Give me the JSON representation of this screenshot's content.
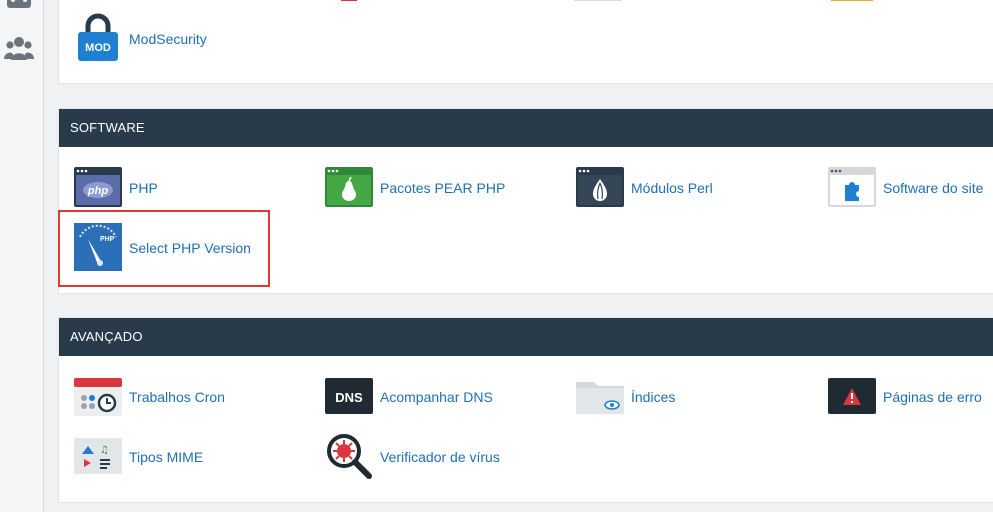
{
  "modsecurity": {
    "label": "ModSecurity",
    "icon": "mod-lock-icon",
    "badge": "MOD"
  },
  "software": {
    "title": "SOFTWARE",
    "items": [
      {
        "label": "PHP",
        "icon": "php-window-icon",
        "badge": "php"
      },
      {
        "label": "Pacotes PEAR PHP",
        "icon": "pear-window-icon"
      },
      {
        "label": "Módulos Perl",
        "icon": "perl-onion-window-icon"
      },
      {
        "label": "Software do site",
        "icon": "puzzle-window-icon"
      },
      {
        "label": "Select PHP Version",
        "icon": "php-gauge-icon",
        "badge": "PHP"
      }
    ]
  },
  "avancado": {
    "title": "AVANÇADO",
    "items": [
      {
        "label": "Trabalhos Cron",
        "icon": "calendar-clock-icon"
      },
      {
        "label": "Acompanhar DNS",
        "icon": "dns-icon",
        "badge": "DNS"
      },
      {
        "label": "Índices",
        "icon": "folder-eye-icon"
      },
      {
        "label": "Páginas de erro",
        "icon": "warning-window-icon"
      },
      {
        "label": "Tipos MIME",
        "icon": "mime-types-icon"
      },
      {
        "label": "Verificador de vírus",
        "icon": "virus-magnifier-icon"
      }
    ]
  },
  "colors": {
    "header": "#293a4a",
    "link": "#1f6fb5",
    "highlight": "#e03a35"
  }
}
